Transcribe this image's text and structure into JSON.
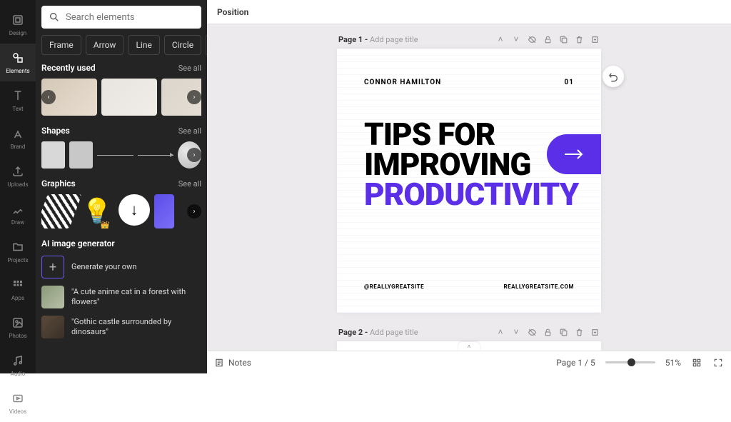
{
  "rail": {
    "items": [
      {
        "id": "design",
        "label": "Design"
      },
      {
        "id": "elements",
        "label": "Elements"
      },
      {
        "id": "text",
        "label": "Text"
      },
      {
        "id": "brand",
        "label": "Brand"
      },
      {
        "id": "uploads",
        "label": "Uploads"
      },
      {
        "id": "draw",
        "label": "Draw"
      },
      {
        "id": "projects",
        "label": "Projects"
      },
      {
        "id": "apps",
        "label": "Apps"
      },
      {
        "id": "photos",
        "label": "Photos"
      },
      {
        "id": "audio",
        "label": "Audio"
      },
      {
        "id": "videos",
        "label": "Videos"
      }
    ],
    "active": 1
  },
  "search": {
    "placeholder": "Search elements"
  },
  "chips": [
    "Frame",
    "Arrow",
    "Line",
    "Circle"
  ],
  "sections": {
    "recent": {
      "title": "Recently used",
      "see_all": "See all"
    },
    "shapes": {
      "title": "Shapes",
      "see_all": "See all"
    },
    "graphics": {
      "title": "Graphics",
      "see_all": "See all"
    },
    "ai": {
      "title": "AI image generator",
      "items": [
        {
          "label": "Generate your own"
        },
        {
          "label": "\"A cute anime cat in a forest with flowers\""
        },
        {
          "label": "\"Gothic castle surrounded by dinosaurs\""
        }
      ]
    }
  },
  "topbar": {
    "label": "Position"
  },
  "pages": [
    {
      "num": "Page 1 - ",
      "placeholder": "Add page title",
      "author": "CONNOR HAMILTON",
      "page_no": "01",
      "headline_1": "TIPS FOR",
      "headline_2": "IMPROVING",
      "headline_3": "PRODUCTIVITY",
      "handle": "@REALLYGREATSITE",
      "website": "REALLYGREATSITE.COM"
    },
    {
      "num": "Page 2 - ",
      "placeholder": "Add page title"
    }
  ],
  "bottom": {
    "notes": "Notes",
    "page_indicator": "Page 1 / 5",
    "zoom": "51%"
  },
  "colors": {
    "accent": "#5b2ee8"
  }
}
